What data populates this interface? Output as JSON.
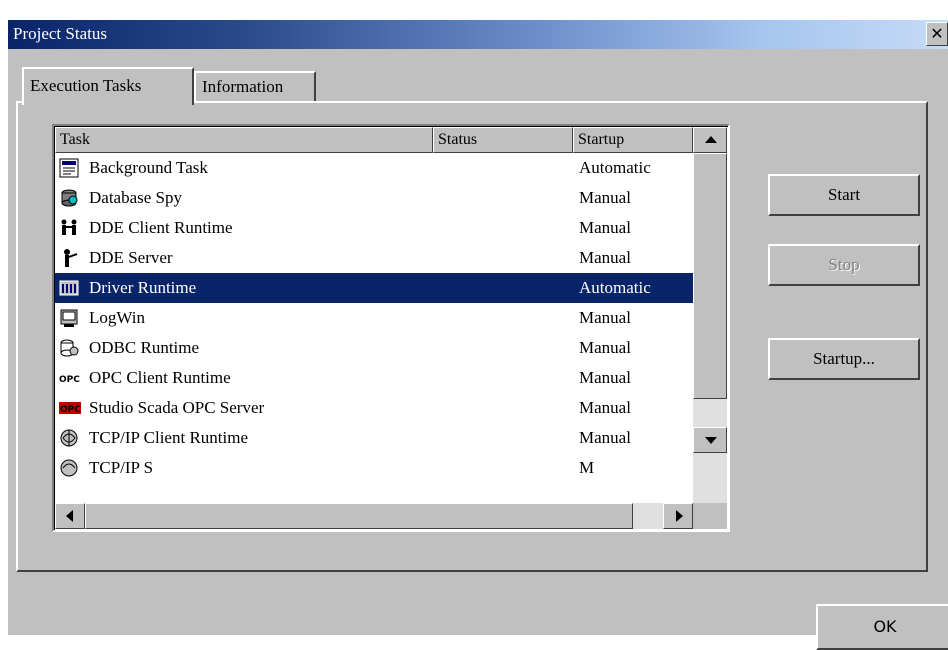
{
  "window": {
    "title": "Project Status",
    "close_glyph": "✕"
  },
  "tabs": [
    {
      "label": "Execution Tasks",
      "active": true
    },
    {
      "label": "Information",
      "active": false
    }
  ],
  "list": {
    "columns": [
      "Task",
      "Status",
      "Startup"
    ],
    "rows": [
      {
        "icon": "background-task-icon",
        "name": "Background Task",
        "status": "",
        "startup": "Automatic",
        "selected": false
      },
      {
        "icon": "database-spy-icon",
        "name": "Database Spy",
        "status": "",
        "startup": "Manual",
        "selected": false
      },
      {
        "icon": "dde-client-icon",
        "name": "DDE Client Runtime",
        "status": "",
        "startup": "Manual",
        "selected": false
      },
      {
        "icon": "dde-server-icon",
        "name": "DDE Server",
        "status": "",
        "startup": "Manual",
        "selected": false
      },
      {
        "icon": "driver-runtime-icon",
        "name": "Driver Runtime",
        "status": "",
        "startup": "Automatic",
        "selected": true
      },
      {
        "icon": "logwin-icon",
        "name": "LogWin",
        "status": "",
        "startup": "Manual",
        "selected": false
      },
      {
        "icon": "odbc-runtime-icon",
        "name": "ODBC Runtime",
        "status": "",
        "startup": "Manual",
        "selected": false
      },
      {
        "icon": "opc-client-icon",
        "name": "OPC Client Runtime",
        "status": "",
        "startup": "Manual",
        "selected": false
      },
      {
        "icon": "opc-server-icon",
        "name": "Studio Scada OPC Server",
        "status": "",
        "startup": "Manual",
        "selected": false
      },
      {
        "icon": "tcpip-client-icon",
        "name": "TCP/IP Client Runtime",
        "status": "",
        "startup": "Manual",
        "selected": false
      },
      {
        "icon": "tcpip-server-icon",
        "name": "TCP/IP S",
        "status": "",
        "startup": "M",
        "selected": false
      }
    ]
  },
  "buttons": {
    "start": "Start",
    "stop": "Stop",
    "startup": "Startup...",
    "ok": "OK"
  },
  "colors": {
    "selection": "#0a246a",
    "face": "#c0c0c0"
  }
}
